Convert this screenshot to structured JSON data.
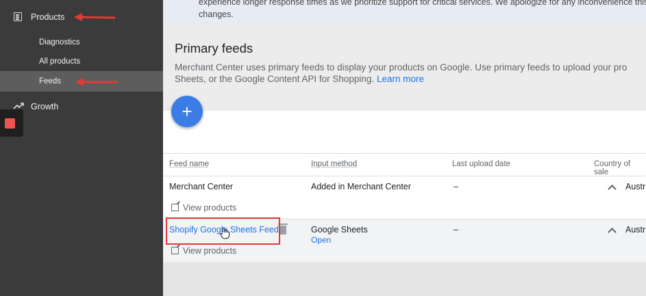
{
  "sidebar": {
    "items": [
      {
        "label": "Products"
      },
      {
        "label": "Diagnostics"
      },
      {
        "label": "All products"
      },
      {
        "label": "Feeds"
      },
      {
        "label": "Growth"
      }
    ]
  },
  "banner": {
    "text_line1": "experience longer response times as we prioritize support for critical services. We apologize for any inconvenience this",
    "text_line2": "changes."
  },
  "page": {
    "title": "Primary feeds",
    "desc_line1": "Merchant Center uses primary feeds to display your products on Google. Use primary feeds to upload your pro",
    "desc_line2": "Sheets, or the Google Content API for Shopping.",
    "learn_more": "Learn more"
  },
  "fab": {
    "symbol": "+"
  },
  "table": {
    "headers": [
      "Feed name",
      "Input method",
      "Last upload date",
      "Country of sale"
    ],
    "rows": [
      {
        "feed_name": "Merchant Center",
        "input_method": "Added in Merchant Center",
        "last_upload": "–",
        "country": "Austr",
        "view": "View products"
      },
      {
        "feed_name": "Shopify Google Sheets Feed",
        "input_method": "Google Sheets",
        "input_sub": "Open",
        "last_upload": "–",
        "country": "Austr",
        "view": "View products"
      }
    ]
  },
  "colors": {
    "accent": "#1a73e8",
    "annotation": "#e53935",
    "sidebar_bg": "#3b3b3b"
  },
  "icons": [
    "list-icon",
    "trending-up-icon",
    "add-icon",
    "open-in-new-icon",
    "chevron-up-icon",
    "trash-icon",
    "hand-cursor-icon"
  ]
}
